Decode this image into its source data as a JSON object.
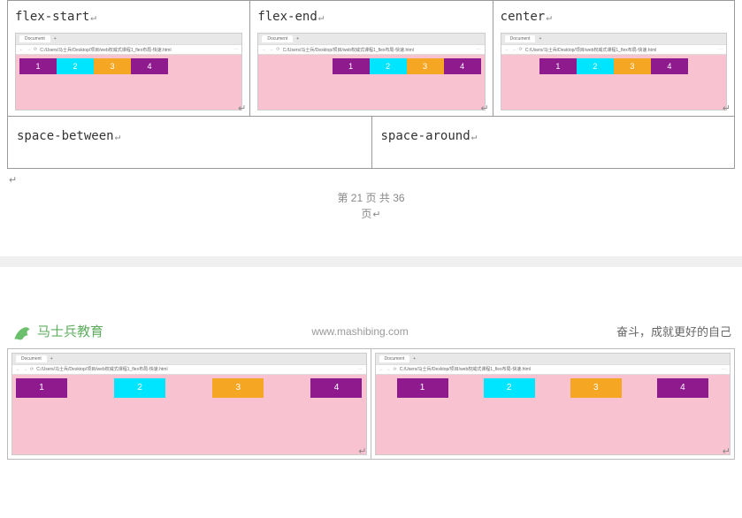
{
  "row1": {
    "cells": [
      {
        "label": "flex-start",
        "justify": "fs"
      },
      {
        "label": "flex-end",
        "justify": "fe"
      },
      {
        "label": "center",
        "justify": "ce"
      }
    ]
  },
  "row2": {
    "cells": [
      {
        "label": "space-between"
      },
      {
        "label": "space-around"
      }
    ]
  },
  "browser": {
    "tab": "Document",
    "url": "C:/Users/马士兵/Desktop/项目/web权威式课程1_flex布局-快速.html"
  },
  "flex_items": [
    "1",
    "2",
    "3",
    "4"
  ],
  "page_info_1": "第",
  "page_num": "21",
  "page_info_2": "页 共",
  "page_total": "36",
  "page_info_3": "页",
  "logo_text": "马士兵教育",
  "site": "www.mashibing.com",
  "slogan": "奋斗，成就更好的自己",
  "bottom": {
    "cells": [
      {
        "justify": "sb"
      },
      {
        "justify": "sa"
      }
    ]
  },
  "ret_glyph": "↵"
}
